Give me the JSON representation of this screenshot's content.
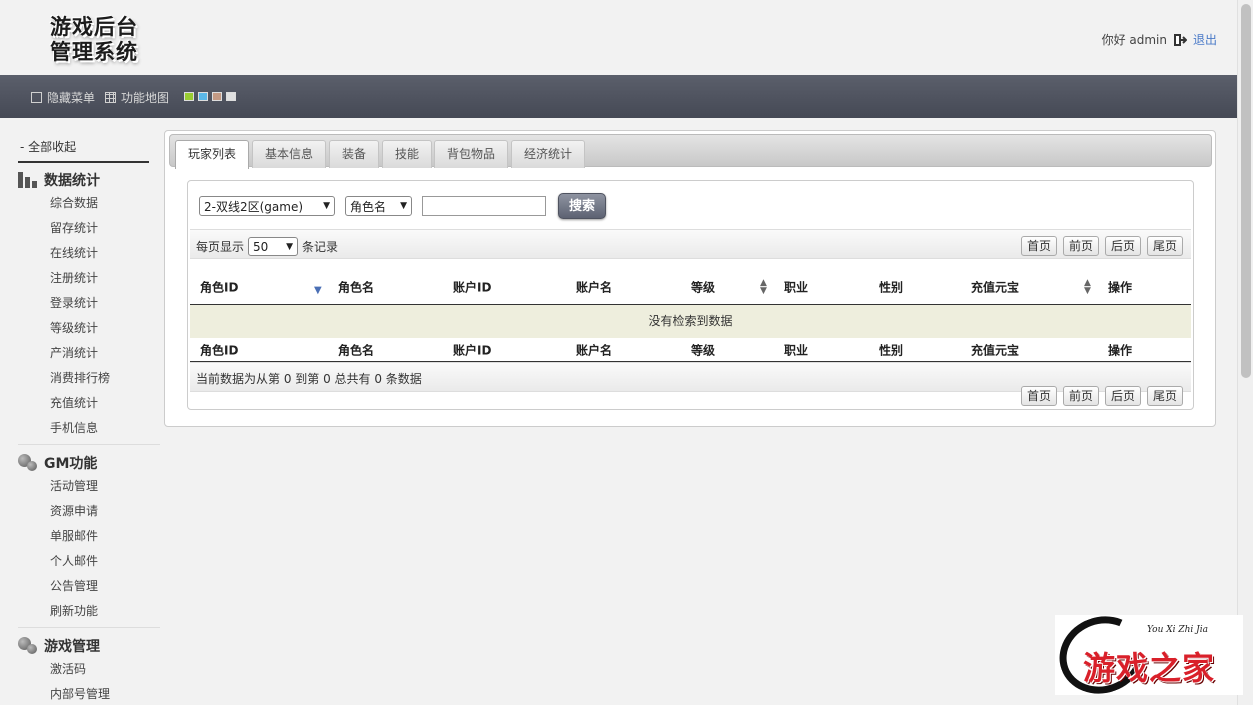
{
  "header": {
    "logo_line1": "游戏后台",
    "logo_line2": "管理系统",
    "greeting": "你好 admin",
    "logout": "退出"
  },
  "toolbar": {
    "hide_menu": "隐藏菜单",
    "sitemap": "功能地图",
    "theme_colors": [
      "#9acd32",
      "#5bb8e8",
      "#c49a84",
      "#e0e0e0"
    ]
  },
  "sidebar": {
    "collapse_all": "- 全部收起",
    "groups": [
      {
        "title": "数据统计",
        "icon": "bar-chart-icon",
        "items": [
          "综合数据",
          "留存统计",
          "在线统计",
          "注册统计",
          "登录统计",
          "等级统计",
          "产消统计",
          "消费排行榜",
          "充值统计",
          "手机信息"
        ]
      },
      {
        "title": "GM功能",
        "icon": "gears-icon",
        "items": [
          "活动管理",
          "资源申请",
          "单服邮件",
          "个人邮件",
          "公告管理",
          "刷新功能"
        ]
      },
      {
        "title": "游戏管理",
        "icon": "gears-icon",
        "items": [
          "激活码",
          "内部号管理"
        ]
      }
    ]
  },
  "tabs": [
    "玩家列表",
    "基本信息",
    "装备",
    "技能",
    "背包物品",
    "经济统计"
  ],
  "search": {
    "server_select": "2-双线2区(game)",
    "field_select": "角色名",
    "query_value": "",
    "button": "搜索"
  },
  "table": {
    "page_size_prefix": "每页显示",
    "page_size": "50",
    "page_size_suffix": "条记录",
    "columns": [
      "角色ID",
      "角色名",
      "账户ID",
      "账户名",
      "等级",
      "职业",
      "性别",
      "充值元宝",
      "操作"
    ],
    "empty_message": "没有检索到数据",
    "info": "当前数据为从第 0 到第 0 总共有 0 条数据",
    "pager": [
      "首页",
      "前页",
      "后页",
      "尾页"
    ]
  },
  "watermark": {
    "script": "You Xi Zhi Jia",
    "text": "游戏之家"
  }
}
